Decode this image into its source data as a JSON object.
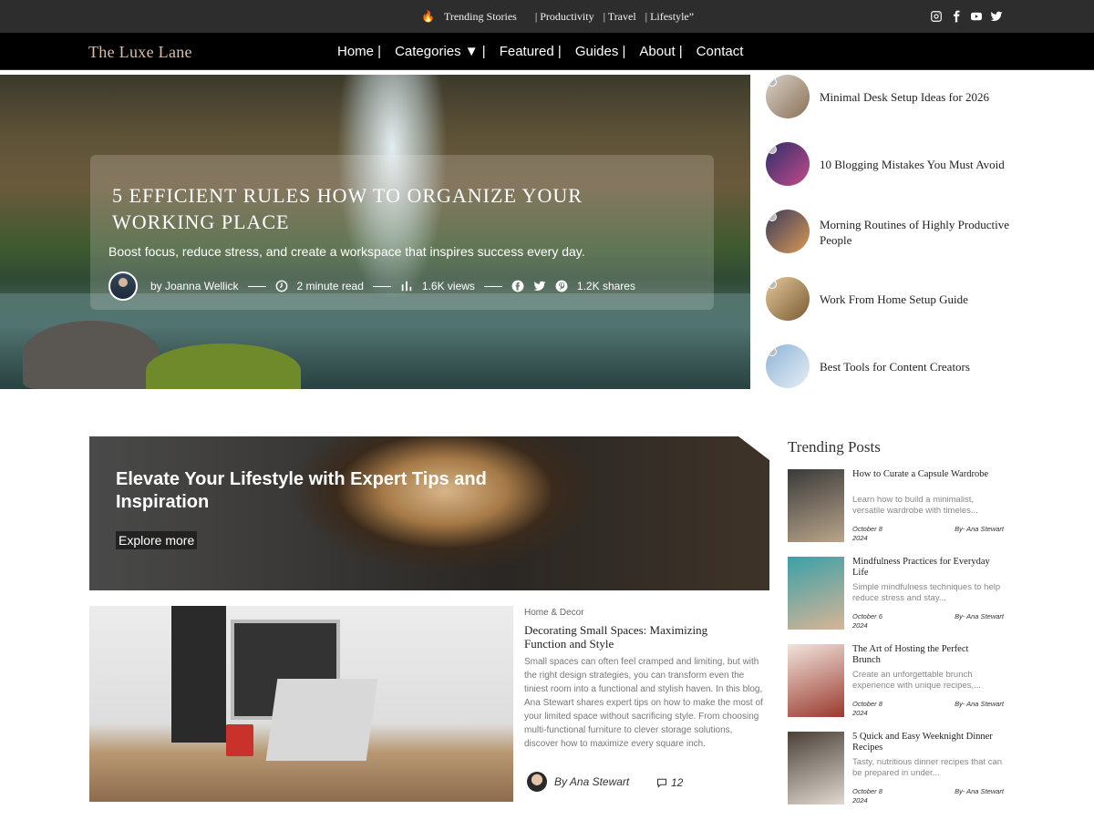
{
  "topbar": {
    "links": [
      "Trending Stories",
      "| Productivity",
      "| Travel",
      "| Lifestyle”"
    ],
    "socials": [
      "instagram-icon",
      "facebook-icon",
      "youtube-icon",
      "twitter-icon"
    ]
  },
  "nav": {
    "brand": "The Luxe Lane",
    "items": [
      "Home |",
      "Categories ▼ |",
      "Featured |",
      "Guides |",
      "About |",
      "Contact"
    ]
  },
  "hero": {
    "title": "5 Efficient Rules How to Organize Your Working Place",
    "subtitle": "Boost focus, reduce stress, and create a workspace that inspires success every day.",
    "author": "by Joanna Wellick",
    "read_time": "2 minute read",
    "views": "1.6K views",
    "shares": "1.2K shares"
  },
  "side_posts": [
    {
      "title": "Minimal Desk Setup Ideas for 2026",
      "thumb": [
        "#d8d2c8",
        "#8a6f55"
      ]
    },
    {
      "title": "10 Blogging Mistakes You Must Avoid",
      "thumb": [
        "#2d2f6a",
        "#c44a8a"
      ]
    },
    {
      "title": "Morning Routines of Highly Productive People",
      "thumb": [
        "#3b3a5a",
        "#d99a55"
      ]
    },
    {
      "title": "Work From Home Setup Guide",
      "thumb": [
        "#e3c89a",
        "#7a5a32"
      ]
    },
    {
      "title": "Best Tools for Content Creators",
      "thumb": [
        "#8fb4d8",
        "#e6eef5"
      ]
    }
  ],
  "promo": {
    "title": "Elevate Your Lifestyle with Expert Tips and Inspiration",
    "button": "Explore more"
  },
  "article": {
    "category": "Home & Decor",
    "title": "Decorating Small Spaces: Maximizing Function and Style",
    "body": "Small spaces can often feel cramped and limiting, but with the right design strategies, you can transform even the tiniest room into a functional and stylish haven. In this blog, Ana Stewart shares expert tips on how to make the most of your limited space without sacrificing style. From choosing multi-functional furniture to clever storage solutions, discover how to maximize every square inch.",
    "author": "By Ana Stewart",
    "comments": "12"
  },
  "trending": {
    "heading": "Trending Posts",
    "posts": [
      {
        "title": "How to Curate a Capsule Wardrobe",
        "desc": "Learn how to build a minimalist, versatile wardrobe with timeles...",
        "date": "October 8 2024",
        "by": "By- Ana Stewart",
        "thumb": [
          "#3a3a3a",
          "#b9a58a"
        ]
      },
      {
        "title": "Mindfulness Practices for Everyday Life",
        "desc": "Simple mindfulness techniques to help reduce stress and stay...",
        "date": "October 6 2024",
        "by": "By- Ana Stewart",
        "thumb": [
          "#3aa0a8",
          "#d8b596"
        ]
      },
      {
        "title": "The Art of Hosting the Perfect Brunch",
        "desc": "Create an unforgettable brunch experience with unique recipes,...",
        "date": "October 8 2024",
        "by": "By- Ana Stewart",
        "thumb": [
          "#f1e4dc",
          "#9a3a2e"
        ]
      },
      {
        "title": "5 Quick and Easy Weeknight Dinner Recipes",
        "desc": "Tasty, nutritious dinner recipes that can be prepared in under...",
        "date": "October 8 2024",
        "by": "By- Ana Stewart",
        "thumb": [
          "#4a4038",
          "#e0d9cf"
        ]
      }
    ]
  }
}
